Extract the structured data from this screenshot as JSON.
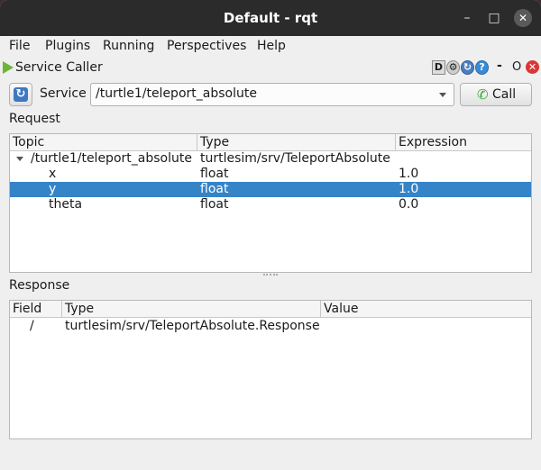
{
  "window": {
    "title": "Default - rqt"
  },
  "menu": [
    {
      "label": "File"
    },
    {
      "label": "Plugins"
    },
    {
      "label": "Running"
    },
    {
      "label": "Perspectives"
    },
    {
      "label": "Help"
    }
  ],
  "plugin": {
    "title": "Service Caller",
    "header_buttons": {
      "d_label": "D",
      "dash_label": "-",
      "o_label": "O"
    }
  },
  "service": {
    "label": "Service",
    "value": "/turtle1/teleport_absolute",
    "call_label": "Call"
  },
  "request": {
    "section_label": "Request",
    "columns": [
      "Topic",
      "Type",
      "Expression"
    ],
    "rows": [
      {
        "topic": "/turtle1/teleport_absolute",
        "type": "turtlesim/srv/TeleportAbsolute",
        "expression": ""
      },
      {
        "topic": "x",
        "type": "float",
        "expression": "1.0"
      },
      {
        "topic": "y",
        "type": "float",
        "expression": "1.0"
      },
      {
        "topic": "theta",
        "type": "float",
        "expression": "0.0"
      }
    ]
  },
  "response": {
    "section_label": "Response",
    "columns": [
      "Field",
      "Type",
      "Value"
    ],
    "rows": [
      {
        "field": "/",
        "type": "turtlesim/srv/TeleportAbsolute.Response",
        "value": ""
      }
    ]
  },
  "colors": {
    "selection": "#3584c8",
    "titlebar": "#2b2b2b",
    "close": "#d93636"
  }
}
